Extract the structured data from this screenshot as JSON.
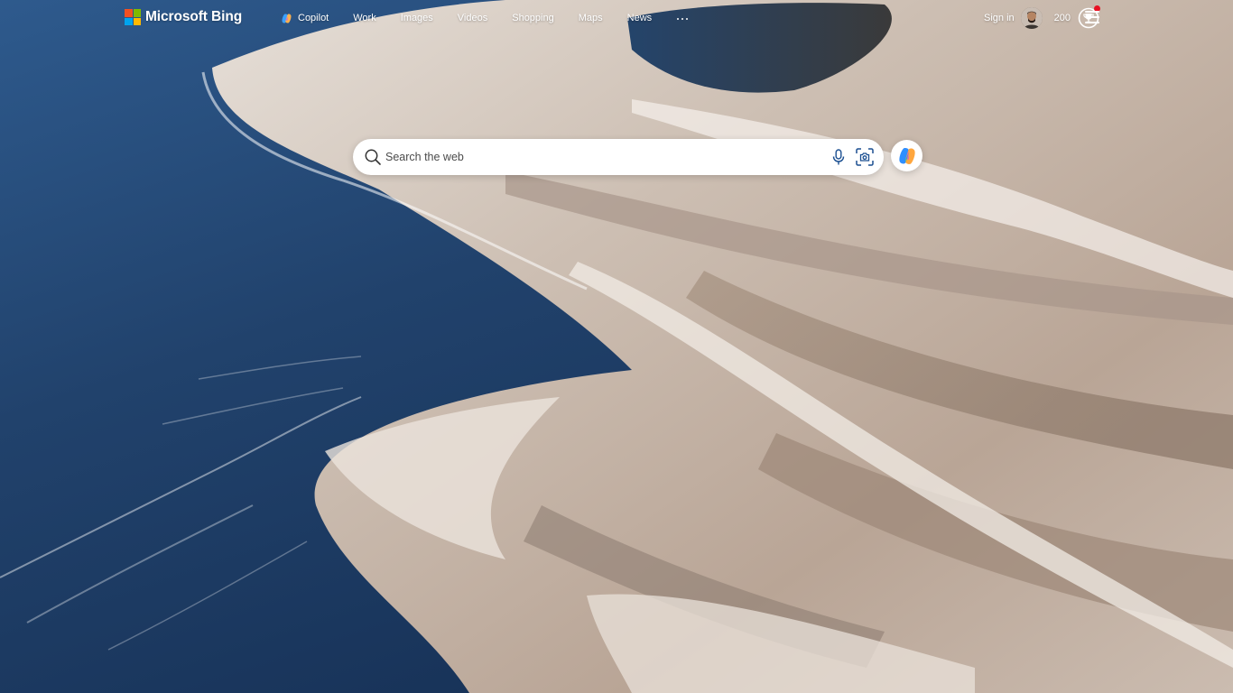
{
  "brand": {
    "name": "Microsoft Bing",
    "logo_colors": [
      "#f25022",
      "#7fba00",
      "#00a4ef",
      "#ffb900"
    ]
  },
  "nav": {
    "items": [
      {
        "label": "Copilot",
        "icon": "copilot-icon"
      },
      {
        "label": "Work"
      },
      {
        "label": "Images"
      },
      {
        "label": "Videos"
      },
      {
        "label": "Shopping"
      },
      {
        "label": "Maps"
      },
      {
        "label": "News"
      }
    ],
    "more_icon": "more-dots-icon"
  },
  "account": {
    "sign_in_label": "Sign in",
    "avatar_icon": "avatar",
    "points": "200",
    "rewards_icon": "trophy-icon",
    "notification_color": "#e81123",
    "menu_icon": "hamburger-menu-icon"
  },
  "search": {
    "placeholder": "Search the web",
    "value": "",
    "icons": [
      "search-icon",
      "microphone-icon",
      "visual-search-icon"
    ]
  },
  "copilot_button": {
    "icon": "copilot-icon"
  }
}
